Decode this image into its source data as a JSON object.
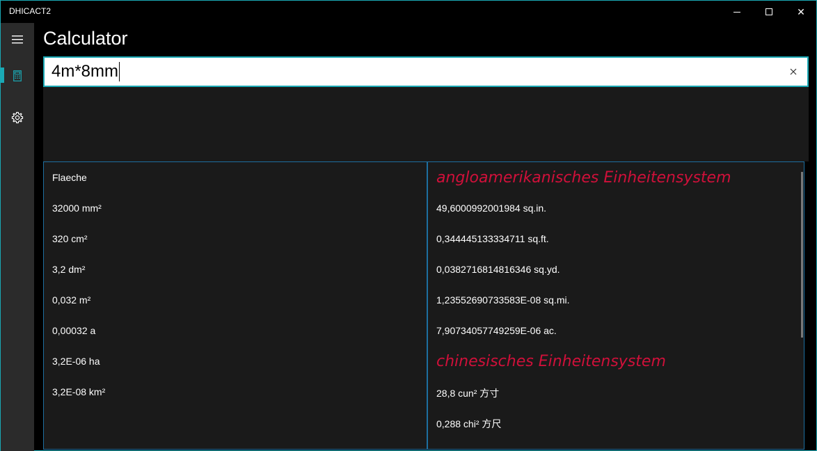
{
  "window": {
    "app_title": "DHICACT2",
    "minimize_glyph": "—",
    "close_glyph": "✕"
  },
  "header": {
    "page_title": "Calculator"
  },
  "search": {
    "value": "4m*8mm",
    "clear_glyph": "✕"
  },
  "left_panel": {
    "heading": "Flaeche",
    "items": [
      "32000 mm²",
      "320 cm²",
      "3,2 dm²",
      "0,032 m²",
      "0,00032 a",
      "3,2E-06 ha",
      "3,2E-08 km²"
    ]
  },
  "right_panel": {
    "section1_title": "angloamerikanisches Einheitensystem",
    "section1_items": [
      "49,6000992001984 sq.in.",
      "0,344445133334711 sq.ft.",
      "0,0382716814816346 sq.yd.",
      "1,23552690733583E-08 sq.mi.",
      "7,90734057749259E-06 ac."
    ],
    "section2_title": "chinesisches Einheitensystem",
    "section2_items": [
      "28,8 cun² 方寸",
      "0,288 chi² 方尺"
    ]
  },
  "icons": {
    "hamburger": "hamburger-icon",
    "calculator": "calculator-icon",
    "settings": "gear-icon"
  },
  "colors": {
    "accent": "#1aa9b5",
    "heading_red": "#d0103a",
    "panel_bg": "#1a1a1a",
    "sidebar_bg": "#2b2b2b"
  }
}
